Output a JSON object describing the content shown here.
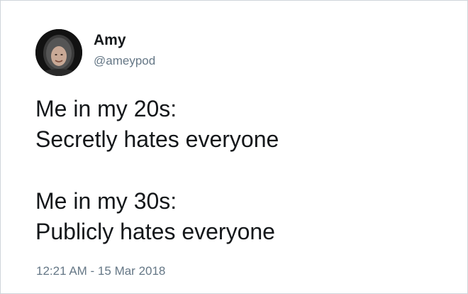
{
  "user": {
    "display_name": "Amy",
    "handle": "@ameypod"
  },
  "tweet": {
    "lines": [
      "Me in my 20s:",
      "Secretly hates everyone",
      "",
      "Me in my 30s:",
      "Publicly hates everyone"
    ],
    "timestamp": "12:21 AM - 15 Mar 2018"
  },
  "colors": {
    "text": "#14171a",
    "secondary_text": "#657786",
    "border": "#cfd5da"
  }
}
